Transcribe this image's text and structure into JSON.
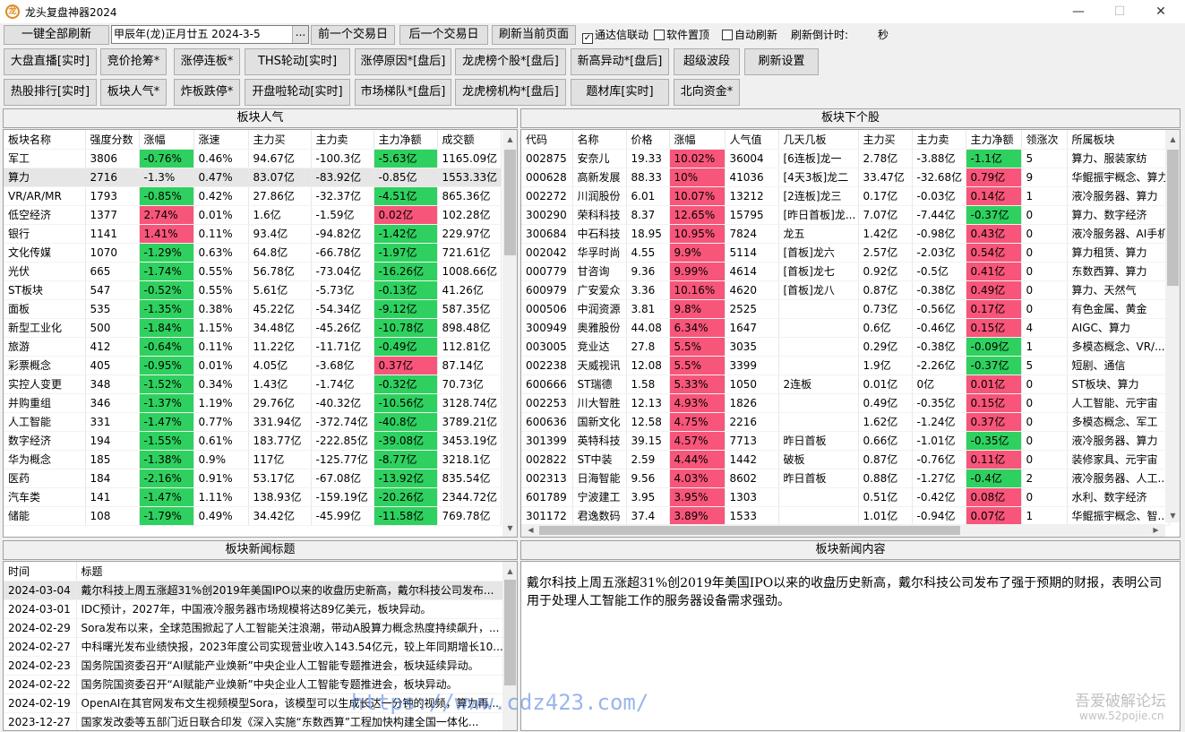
{
  "window": {
    "title": "龙头复盘神器2024",
    "minimize": "—",
    "maximize": "☐",
    "close": "✕"
  },
  "toolbar": {
    "refresh_all": "一键全部刷新",
    "date_value": "甲辰年(龙)正月廿五  2024-3-5",
    "date_picker": "...",
    "prev_day": "前一个交易日",
    "next_day": "后一个交易日",
    "refresh_page": "刷新当前页面",
    "chk_tdx": "通达信联动",
    "chk_tdx_checked": "✓",
    "chk_top": "软件置顶",
    "chk_auto": "自动刷新",
    "countdown_label": "刷新倒计时:",
    "countdown_unit": "秒"
  },
  "nav_row1": [
    "大盘直播[实时]",
    "竞价抢筹*",
    "涨停连板*",
    "THS轮动[实时]",
    "涨停原因*[盘后]",
    "龙虎榜个股*[盘后]",
    "新高异动*[盘后]",
    "超级波段",
    "刷新设置"
  ],
  "nav_row2": [
    "热股排行[实时]",
    "板块人气*",
    "炸板跌停*",
    "开盘啦轮动[实时]",
    "市场梯队*[盘后]",
    "龙虎榜机构*[盘后]",
    "题材库[实时]",
    "北向资金*"
  ],
  "sector_panel": {
    "title": "板块人气",
    "headers": [
      "板块名称",
      "强度分数",
      "涨幅",
      "涨速",
      "主力买",
      "主力卖",
      "主力净额",
      "成交额"
    ],
    "rows": [
      [
        "军工",
        "3806",
        "-0.76%",
        "0.46%",
        "94.67亿",
        "-100.3亿",
        "-5.63亿",
        "1165.09亿"
      ],
      [
        "算力",
        "2716",
        "-1.3%",
        "0.47%",
        "83.07亿",
        "-83.92亿",
        "-0.85亿",
        "1553.33亿"
      ],
      [
        "VR/AR/MR",
        "1793",
        "-0.85%",
        "0.42%",
        "27.86亿",
        "-32.37亿",
        "-4.51亿",
        "865.36亿"
      ],
      [
        "低空经济",
        "1377",
        "2.74%",
        "0.01%",
        "1.6亿",
        "-1.59亿",
        "0.02亿",
        "102.28亿"
      ],
      [
        "银行",
        "1141",
        "1.41%",
        "0.11%",
        "93.4亿",
        "-94.82亿",
        "-1.42亿",
        "229.97亿"
      ],
      [
        "文化传媒",
        "1070",
        "-1.29%",
        "0.63%",
        "64.8亿",
        "-66.78亿",
        "-1.97亿",
        "721.61亿"
      ],
      [
        "光伏",
        "665",
        "-1.74%",
        "0.55%",
        "56.78亿",
        "-73.04亿",
        "-16.26亿",
        "1008.66亿"
      ],
      [
        "ST板块",
        "547",
        "-0.52%",
        "0.55%",
        "5.61亿",
        "-5.73亿",
        "-0.13亿",
        "41.26亿"
      ],
      [
        "面板",
        "535",
        "-1.35%",
        "0.38%",
        "45.22亿",
        "-54.34亿",
        "-9.12亿",
        "587.35亿"
      ],
      [
        "新型工业化",
        "500",
        "-1.84%",
        "1.15%",
        "34.48亿",
        "-45.26亿",
        "-10.78亿",
        "898.48亿"
      ],
      [
        "旅游",
        "412",
        "-0.64%",
        "0.11%",
        "11.22亿",
        "-11.71亿",
        "-0.49亿",
        "112.81亿"
      ],
      [
        "彩票概念",
        "405",
        "-0.95%",
        "0.01%",
        "4.05亿",
        "-3.68亿",
        "0.37亿",
        "87.14亿"
      ],
      [
        "实控人变更",
        "348",
        "-1.52%",
        "0.34%",
        "1.43亿",
        "-1.74亿",
        "-0.32亿",
        "70.73亿"
      ],
      [
        "并购重组",
        "346",
        "-1.37%",
        "1.19%",
        "29.76亿",
        "-40.32亿",
        "-10.56亿",
        "3128.74亿"
      ],
      [
        "人工智能",
        "331",
        "-1.47%",
        "0.77%",
        "331.94亿",
        "-372.74亿",
        "-40.8亿",
        "3789.21亿"
      ],
      [
        "数字经济",
        "194",
        "-1.55%",
        "0.61%",
        "183.77亿",
        "-222.85亿",
        "-39.08亿",
        "3453.19亿"
      ],
      [
        "华为概念",
        "185",
        "-1.38%",
        "0.9%",
        "117亿",
        "-125.77亿",
        "-8.77亿",
        "3218.1亿"
      ],
      [
        "医药",
        "184",
        "-2.16%",
        "0.91%",
        "53.17亿",
        "-67.08亿",
        "-13.92亿",
        "835.54亿"
      ],
      [
        "汽车类",
        "141",
        "-1.47%",
        "1.11%",
        "138.93亿",
        "-159.19亿",
        "-20.26亿",
        "2344.72亿"
      ],
      [
        "储能",
        "108",
        "-1.79%",
        "0.49%",
        "34.42亿",
        "-45.99亿",
        "-11.58亿",
        "769.78亿"
      ]
    ]
  },
  "stock_panel": {
    "title": "板块下个股",
    "headers": [
      "代码",
      "名称",
      "价格",
      "涨幅",
      "人气值",
      "几天几板",
      "主力买",
      "主力卖",
      "主力净额",
      "领涨次",
      "所属板块"
    ],
    "rows": [
      [
        "002875",
        "安奈儿",
        "19.33",
        "10.02%",
        "36004",
        "[6连板]龙一",
        "2.78亿",
        "-3.88亿",
        "-1.1亿",
        "5",
        "算力、服装家纺"
      ],
      [
        "000628",
        "高新发展",
        "88.33",
        "10%",
        "41036",
        "[4天3板]龙二",
        "33.47亿",
        "-32.68亿",
        "0.79亿",
        "9",
        "华鲲振宇概念、算力"
      ],
      [
        "002272",
        "川润股份",
        "6.01",
        "10.07%",
        "13212",
        "[2连板]龙三",
        "0.17亿",
        "-0.03亿",
        "0.14亿",
        "1",
        "液冷服务器、算力"
      ],
      [
        "300290",
        "荣科科技",
        "8.37",
        "12.65%",
        "15795",
        "[昨日首板]龙...",
        "7.07亿",
        "-7.44亿",
        "-0.37亿",
        "0",
        "算力、数字经济"
      ],
      [
        "300684",
        "中石科技",
        "18.95",
        "10.95%",
        "7824",
        "龙五",
        "1.42亿",
        "-0.98亿",
        "0.43亿",
        "0",
        "液冷服务器、AI手机"
      ],
      [
        "002042",
        "华孚时尚",
        "4.55",
        "9.9%",
        "5114",
        "[首板]龙六",
        "2.57亿",
        "-2.03亿",
        "0.54亿",
        "0",
        "算力租赁、算力"
      ],
      [
        "000779",
        "甘咨询",
        "9.36",
        "9.99%",
        "4614",
        "[首板]龙七",
        "0.92亿",
        "-0.5亿",
        "0.41亿",
        "0",
        "东数西算、算力"
      ],
      [
        "600979",
        "广安爱众",
        "3.36",
        "10.16%",
        "4620",
        "[首板]龙八",
        "0.87亿",
        "-0.38亿",
        "0.49亿",
        "0",
        "算力、天然气"
      ],
      [
        "000506",
        "中润资源",
        "3.81",
        "9.8%",
        "2525",
        "",
        "0.73亿",
        "-0.56亿",
        "0.17亿",
        "0",
        "有色金属、黄金"
      ],
      [
        "300949",
        "奥雅股份",
        "44.08",
        "6.34%",
        "1647",
        "",
        "0.6亿",
        "-0.46亿",
        "0.15亿",
        "4",
        "AIGC、算力"
      ],
      [
        "003005",
        "竞业达",
        "27.8",
        "5.5%",
        "3035",
        "",
        "0.29亿",
        "-0.38亿",
        "-0.09亿",
        "1",
        "多模态概念、VR/..."
      ],
      [
        "002238",
        "天威视讯",
        "12.08",
        "5.5%",
        "3399",
        "",
        "1.9亿",
        "-2.26亿",
        "-0.37亿",
        "5",
        "短剧、通信"
      ],
      [
        "600666",
        "ST瑞德",
        "1.58",
        "5.33%",
        "1050",
        "2连板",
        "0.01亿",
        "0亿",
        "0.01亿",
        "0",
        "ST板块、算力"
      ],
      [
        "002253",
        "川大智胜",
        "12.13",
        "4.93%",
        "1826",
        "",
        "0.49亿",
        "-0.35亿",
        "0.15亿",
        "0",
        "人工智能、元宇宙"
      ],
      [
        "600636",
        "国新文化",
        "12.58",
        "4.75%",
        "2216",
        "",
        "1.62亿",
        "-1.24亿",
        "0.37亿",
        "0",
        "多模态概念、军工"
      ],
      [
        "301399",
        "英特科技",
        "39.15",
        "4.57%",
        "7713",
        "昨日首板",
        "0.66亿",
        "-1.01亿",
        "-0.35亿",
        "0",
        "液冷服务器、算力"
      ],
      [
        "002822",
        "ST中装",
        "2.59",
        "4.44%",
        "1442",
        "破板",
        "0.87亿",
        "-0.76亿",
        "0.11亿",
        "0",
        "装修家具、元宇宙"
      ],
      [
        "002313",
        "日海智能",
        "9.56",
        "4.03%",
        "8602",
        "昨日首板",
        "0.88亿",
        "-1.27亿",
        "-0.4亿",
        "2",
        "液冷服务器、人工..."
      ],
      [
        "601789",
        "宁波建工",
        "3.95",
        "3.95%",
        "1303",
        "",
        "0.51亿",
        "-0.42亿",
        "0.08亿",
        "0",
        "水利、数字经济"
      ],
      [
        "301172",
        "君逸数码",
        "37.4",
        "3.89%",
        "1533",
        "",
        "1.01亿",
        "-0.94亿",
        "0.07亿",
        "1",
        "华鲲振宇概念、智..."
      ]
    ]
  },
  "news_panel": {
    "title": "板块新闻标题",
    "headers": [
      "时间",
      "标题"
    ],
    "rows": [
      [
        "2024-03-04",
        "戴尔科技上周五涨超31%创2019年美国IPO以来的收盘历史新高，戴尔科技公司发布..."
      ],
      [
        "2024-03-01",
        "IDC预计，2027年，中国液冷服务器市场规模将达89亿美元，板块异动。"
      ],
      [
        "2024-02-29",
        "Sora发布以来，全球范围掀起了人工智能关注浪潮，带动A股算力概念热度持续飙升，..."
      ],
      [
        "2024-02-27",
        "中科曙光发布业绩快报，2023年度公司实现营业收入143.54亿元，较上年同期增长10...."
      ],
      [
        "2024-02-23",
        "国务院国资委召开“AI赋能产业焕新”中央企业人工智能专题推进会，板块延续异动。"
      ],
      [
        "2024-02-22",
        "国务院国资委召开“AI赋能产业焕新”中央企业人工智能专题推进会，板块异动。"
      ],
      [
        "2024-02-19",
        "OpenAI在其官网发布文生视频模型Sora，该模型可以生成长达一分钟的视频，算力再..."
      ],
      [
        "2023-12-27",
        "国家发改委等五部门近日联合印发《深入实施“东数西算”工程加快构建全国一体化..."
      ]
    ]
  },
  "content_panel": {
    "title": "板块新闻内容",
    "text": "戴尔科技上周五涨超31%创2019年美国IPO以来的收盘历史新高，戴尔科技公司发布了强于预期的财报，表明公司用于处理人工智能工作的服务器设备需求强劲。"
  },
  "watermark": {
    "url": "https://www.cdz423.com/",
    "site_logo": "吾爱破解论坛",
    "site_url": "www.52pojie.cn"
  },
  "colors": {
    "up": "#f8557a",
    "down": "#2ed15f"
  }
}
